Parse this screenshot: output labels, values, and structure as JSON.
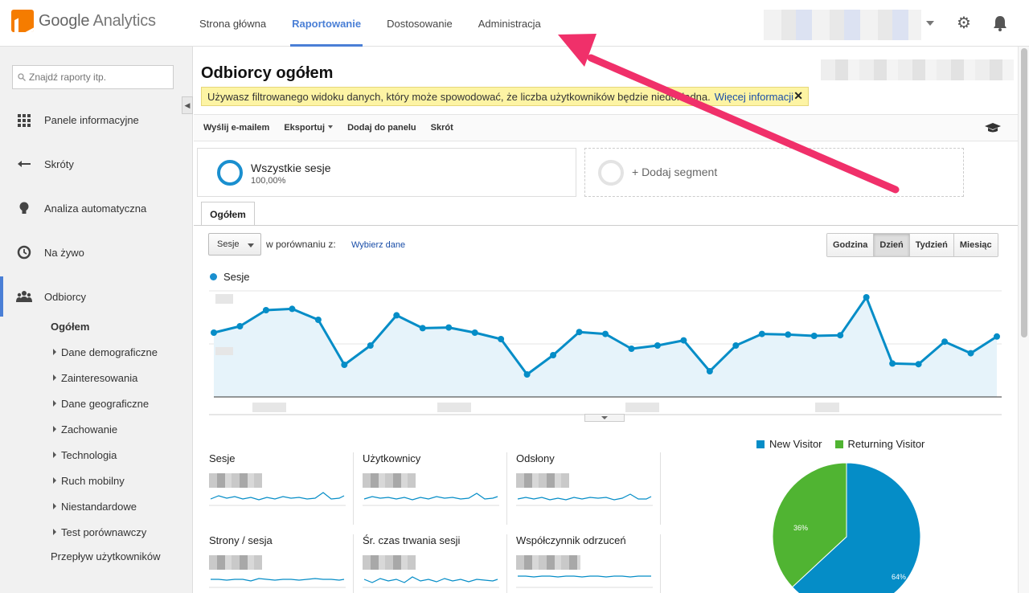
{
  "app": {
    "logo_google": "Google",
    "logo_analytics": "Analytics"
  },
  "topnav": [
    "Strona główna",
    "Raportowanie",
    "Dostosowanie",
    "Administracja"
  ],
  "sidebar": {
    "search_placeholder": "Znajdź raporty itp.",
    "items": [
      "Panele informacyjne",
      "Skróty",
      "Analiza automatyczna",
      "Na żywo",
      "Odbiorcy"
    ],
    "sub_items": [
      "Ogółem",
      "Dane demograficzne",
      "Zainteresowania",
      "Dane geograficzne",
      "Zachowanie",
      "Technologia",
      "Ruch mobilny",
      "Niestandardowe",
      "Test porównawczy",
      "Przepływ użytkowników"
    ]
  },
  "main": {
    "title": "Odbiorcy ogółem",
    "warning": "Używasz filtrowanego widoku danych, który może spowodować, że liczba użytkowników będzie niedokładna.",
    "warning_link": "Więcej informacji",
    "toolbar": [
      "Wyślij e-mailem",
      "Eksportuj",
      "Dodaj do panelu",
      "Skrót"
    ],
    "segment": {
      "name": "Wszystkie sesje",
      "pct": "100,00%",
      "add": "+ Dodaj segment"
    },
    "tab": "Ogółem",
    "metric": "Sesje",
    "compare_label": "w porównaniu z:",
    "compare_link": "Wybierz dane",
    "periods": [
      "Godzina",
      "Dzień",
      "Tydzień",
      "Miesiąc"
    ],
    "legend": "Sesje"
  },
  "metrics": [
    "Sesje",
    "Użytkownicy",
    "Odsłony",
    "Strony / sesja",
    "Śr. czas trwania sesji",
    "Współczynnik odrzuceń"
  ],
  "pie": {
    "legend": [
      "New Visitor",
      "Returning Visitor"
    ],
    "labels": [
      "36%",
      "64%"
    ],
    "colors": [
      "#058dc7",
      "#50b432"
    ]
  },
  "chart_data": {
    "type": "area",
    "series": [
      {
        "name": "Sesje",
        "values": [
          1.0,
          1.1,
          1.35,
          1.37,
          1.2,
          0.5,
          0.8,
          1.27,
          1.07,
          1.08,
          1.0,
          0.9,
          0.35,
          0.65,
          1.01,
          0.98,
          0.75,
          0.8,
          0.88,
          0.4,
          0.8,
          0.98,
          0.97,
          0.95,
          0.96,
          1.55,
          0.52,
          0.51,
          0.86,
          0.68,
          0.94
        ]
      }
    ],
    "colors": {
      "line": "#058dc7",
      "fill": "#e6f3fa"
    },
    "grid": true
  }
}
